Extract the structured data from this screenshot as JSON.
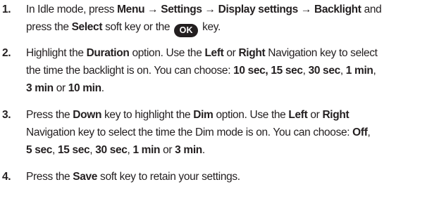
{
  "steps": [
    {
      "number": "1.",
      "lines": [
        [
          {
            "t": "In Idle mode, press ",
            "b": false
          },
          {
            "t": "Menu → Settings → Display settings → Backlight",
            "b": true
          },
          {
            "t": " and",
            "b": false
          }
        ],
        [
          {
            "t": "press the ",
            "b": false
          },
          {
            "t": "Select",
            "b": true
          },
          {
            "t": " soft key or the ",
            "b": false
          },
          {
            "t": "OK",
            "key": true
          },
          {
            "t": " key.",
            "b": false
          }
        ]
      ]
    },
    {
      "number": "2.",
      "lines": [
        [
          {
            "t": "Highlight the ",
            "b": false
          },
          {
            "t": "Duration",
            "b": true
          },
          {
            "t": " option. Use the ",
            "b": false
          },
          {
            "t": "Left",
            "b": true
          },
          {
            "t": " or ",
            "b": false
          },
          {
            "t": "Right",
            "b": true
          },
          {
            "t": " Navigation key to select",
            "b": false
          }
        ],
        [
          {
            "t": "the time the backlight is on. You can choose: ",
            "b": false
          },
          {
            "t": "10 sec, 15 sec",
            "b": true
          },
          {
            "t": ", ",
            "b": false
          },
          {
            "t": "30 sec",
            "b": true
          },
          {
            "t": ", ",
            "b": false
          },
          {
            "t": "1 min",
            "b": true
          },
          {
            "t": ",",
            "b": false
          }
        ],
        [
          {
            "t": "3 min",
            "b": true
          },
          {
            "t": " or ",
            "b": false
          },
          {
            "t": "10 min",
            "b": true
          },
          {
            "t": ".",
            "b": false
          }
        ]
      ]
    },
    {
      "number": "3.",
      "lines": [
        [
          {
            "t": "Press the ",
            "b": false
          },
          {
            "t": "Down",
            "b": true
          },
          {
            "t": " key to highlight the ",
            "b": false
          },
          {
            "t": "Dim",
            "b": true
          },
          {
            "t": " option. Use the ",
            "b": false
          },
          {
            "t": "Left",
            "b": true
          },
          {
            "t": " or ",
            "b": false
          },
          {
            "t": "Right",
            "b": true
          }
        ],
        [
          {
            "t": "Navigation key to select the time the Dim mode is on. You can choose: ",
            "b": false
          },
          {
            "t": "Off",
            "b": true
          },
          {
            "t": ",",
            "b": false
          }
        ],
        [
          {
            "t": "5 sec",
            "b": true
          },
          {
            "t": ", ",
            "b": false
          },
          {
            "t": "15 sec",
            "b": true
          },
          {
            "t": ", ",
            "b": false
          },
          {
            "t": "30 sec",
            "b": true
          },
          {
            "t": ", ",
            "b": false
          },
          {
            "t": "1 min",
            "b": true
          },
          {
            "t": " or ",
            "b": false
          },
          {
            "t": "3 min",
            "b": true
          },
          {
            "t": ".",
            "b": false
          }
        ]
      ]
    },
    {
      "number": "4.",
      "lines": [
        [
          {
            "t": "Press the ",
            "b": false
          },
          {
            "t": "Save",
            "b": true
          },
          {
            "t": " soft key to retain your settings.",
            "b": false
          }
        ]
      ]
    }
  ],
  "ok_key_icon": "ok-key-icon"
}
